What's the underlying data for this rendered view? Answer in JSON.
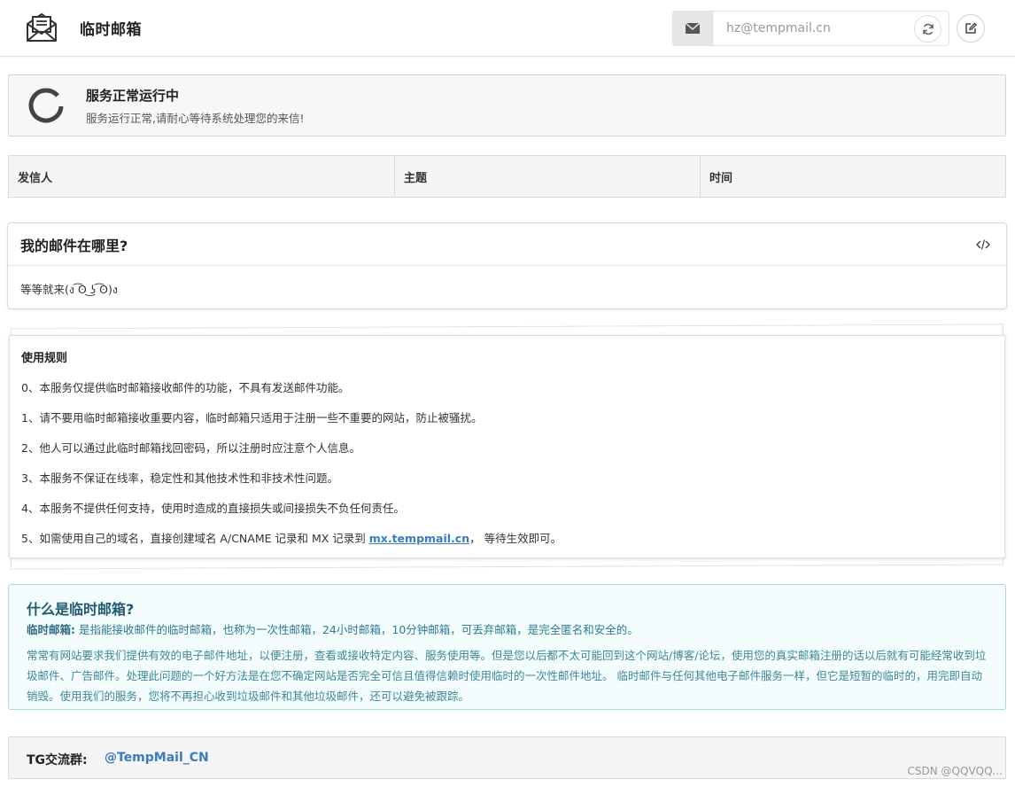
{
  "header": {
    "title": "临时邮箱",
    "email_placeholder": "hz@tempmail.cn",
    "icons": [
      "envelope-open-icon",
      "envelope-icon",
      "refresh-icon",
      "edit-icon"
    ]
  },
  "status": {
    "title": "服务正常运行中",
    "subtitle": "服务运行正常,请耐心等待系统处理您的来信!"
  },
  "mail_table": {
    "columns": [
      "发信人",
      "主题",
      "时间"
    ]
  },
  "where_card": {
    "title": "我的邮件在哪里?",
    "body": "等等就来(ง ͡ʘ ͜ʖ ͡ʘ)ง"
  },
  "rules": {
    "title": "使用规则",
    "items": [
      "0、本服务仅提供临时邮箱接收邮件的功能，不具有发送邮件功能。",
      "1、请不要用临时邮箱接收重要内容，临时邮箱只适用于注册一些不重要的网站，防止被骚扰。",
      "2、他人可以通过此临时邮箱找回密码，所以注册时应注意个人信息。",
      "3、本服务不保证在线率，稳定性和其他技术性和非技术性问题。",
      "4、本服务不提供任何支持，使用时造成的直接损失或间接损失不负任何责任。"
    ],
    "last_prefix": "5、如需使用自己的域名，直接创建域名 A/CNAME 记录和 MX 记录到 ",
    "last_link": "mx.tempmail.cn",
    "last_suffix": "， 等待生效即可。"
  },
  "info": {
    "title": "什么是临时邮箱?",
    "lead_label": "临时邮箱:",
    "lead_text": " 是指能接收邮件的临时邮箱，也称为一次性邮箱，24小时邮箱，10分钟邮箱，可丢弃邮箱，是完全匿名和安全的。",
    "paragraph": "常常有网站要求我们提供有效的电子邮件地址，以便注册，查看或接收特定内容、服务使用等。但是您以后都不太可能回到这个网站/博客/论坛，使用您的真实邮箱注册的话以后就有可能经常收到垃圾邮件、广告邮件。处理此问题的一个好方法是在您不确定网站是否完全可信且值得信赖时使用临时的一次性邮件地址。 临时邮件与任何其他电子邮件服务一样，但它是短暂的临时的，用完即自动销毁。使用我们的服务，您将不再担心收到垃圾邮件和其他垃圾邮件，还可以避免被跟踪。"
  },
  "tg": {
    "label": "TG交流群:",
    "link": "@TempMail_CN"
  },
  "watermark": "CSDN @QQVQQ..."
}
